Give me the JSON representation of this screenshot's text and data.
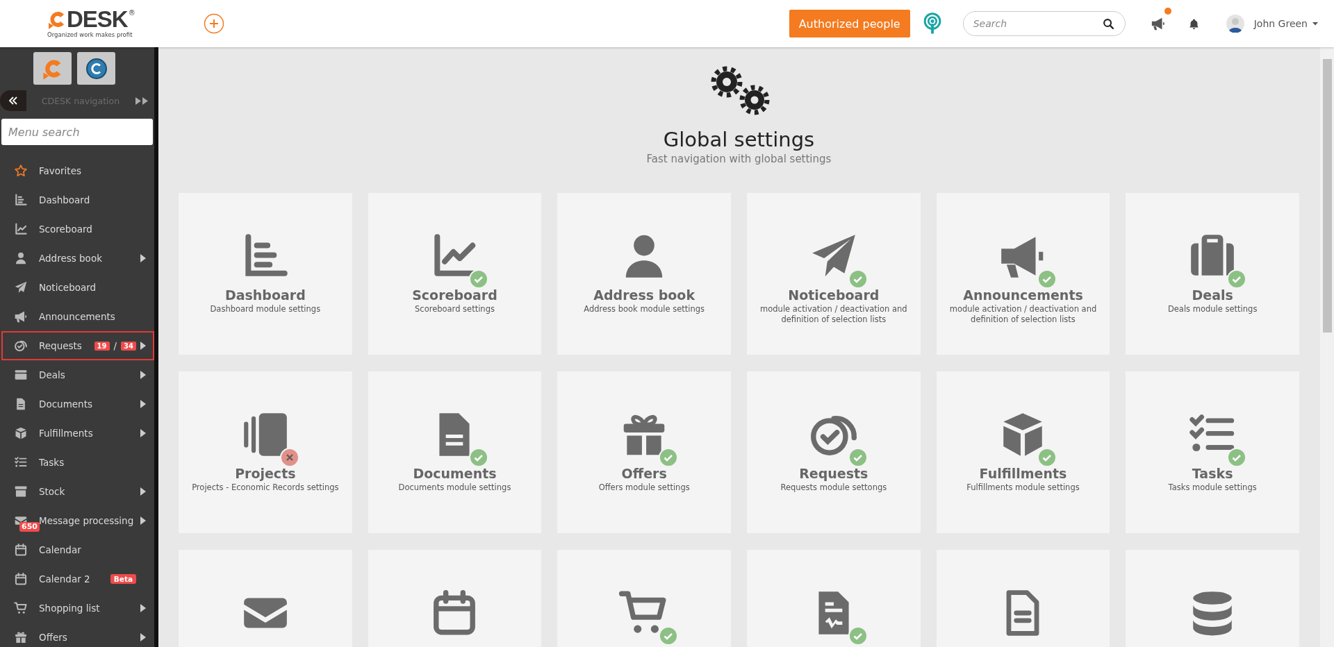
{
  "header": {
    "logo": {
      "wordmark": "DESK",
      "registered": "®",
      "tagline": "Organized work makes profit"
    },
    "authorized_button": "Authorized people",
    "search": {
      "placeholder": "Search"
    },
    "announcements_unread": true,
    "user": {
      "name": "John Green"
    }
  },
  "sidebar": {
    "navigation_label": "CDESK navigation",
    "search": {
      "placeholder": "Menu search"
    },
    "items": [
      {
        "label": "Favorites",
        "submenu": false,
        "selected": false
      },
      {
        "label": "Dashboard",
        "submenu": false,
        "selected": false
      },
      {
        "label": "Scoreboard",
        "submenu": false,
        "selected": false
      },
      {
        "label": "Address book",
        "submenu": true,
        "selected": false
      },
      {
        "label": "Noticeboard",
        "submenu": false,
        "selected": false
      },
      {
        "label": "Announcements",
        "submenu": false,
        "selected": false
      },
      {
        "label": "Requests",
        "submenu": true,
        "selected": true,
        "badges": [
          "19",
          "34"
        ],
        "badge_separator": "/"
      },
      {
        "label": "Deals",
        "submenu": true,
        "selected": false
      },
      {
        "label": "Documents",
        "submenu": true,
        "selected": false
      },
      {
        "label": "Fulfillments",
        "submenu": true,
        "selected": false
      },
      {
        "label": "Tasks",
        "submenu": false,
        "selected": false
      },
      {
        "label": "Stock",
        "submenu": true,
        "selected": false
      },
      {
        "label": "Message processing",
        "submenu": true,
        "selected": false,
        "icon_badge": "650"
      },
      {
        "label": "Calendar",
        "submenu": false,
        "selected": false
      },
      {
        "label": "Calendar 2",
        "submenu": false,
        "selected": false,
        "tag": "Beta"
      },
      {
        "label": "Shopping list",
        "submenu": true,
        "selected": false
      },
      {
        "label": "Offers",
        "submenu": true,
        "selected": false
      }
    ]
  },
  "page": {
    "title": "Global settings",
    "subtitle": "Fast navigation with global settings"
  },
  "tiles": [
    {
      "title": "Dashboard",
      "subtitle": "Dashboard module settings",
      "badge": false
    },
    {
      "title": "Scoreboard",
      "subtitle": "Scoreboard settings",
      "badge": true,
      "active": true
    },
    {
      "title": "Address book",
      "subtitle": "Address book module settings",
      "badge": false
    },
    {
      "title": "Noticeboard",
      "subtitle": "module activation / deactivation and definition of selection lists",
      "badge": true,
      "active": true
    },
    {
      "title": "Announcements",
      "subtitle": "module activation / deactivation and definition of selection lists",
      "badge": true,
      "active": true
    },
    {
      "title": "Deals",
      "subtitle": "Deals module settings",
      "badge": true,
      "active": true
    },
    {
      "title": "Projects",
      "subtitle": "Projects - Economic Records settings",
      "badge": true,
      "active": false
    },
    {
      "title": "Documents",
      "subtitle": "Documents module settings",
      "badge": true,
      "active": true
    },
    {
      "title": "Offers",
      "subtitle": "Offers module settings",
      "badge": true,
      "active": true
    },
    {
      "title": "Requests",
      "subtitle": "Requests module settongs",
      "badge": true,
      "active": true
    },
    {
      "title": "Fulfillments",
      "subtitle": "Fulfillments module settings",
      "badge": true,
      "active": true
    },
    {
      "title": "Tasks",
      "subtitle": "Tasks module settings",
      "badge": true,
      "active": true
    },
    {
      "badge": false
    },
    {
      "badge": false
    },
    {
      "badge": true,
      "active": true
    },
    {
      "badge": true,
      "active": true
    },
    {
      "badge": false
    },
    {
      "badge": false
    }
  ]
}
